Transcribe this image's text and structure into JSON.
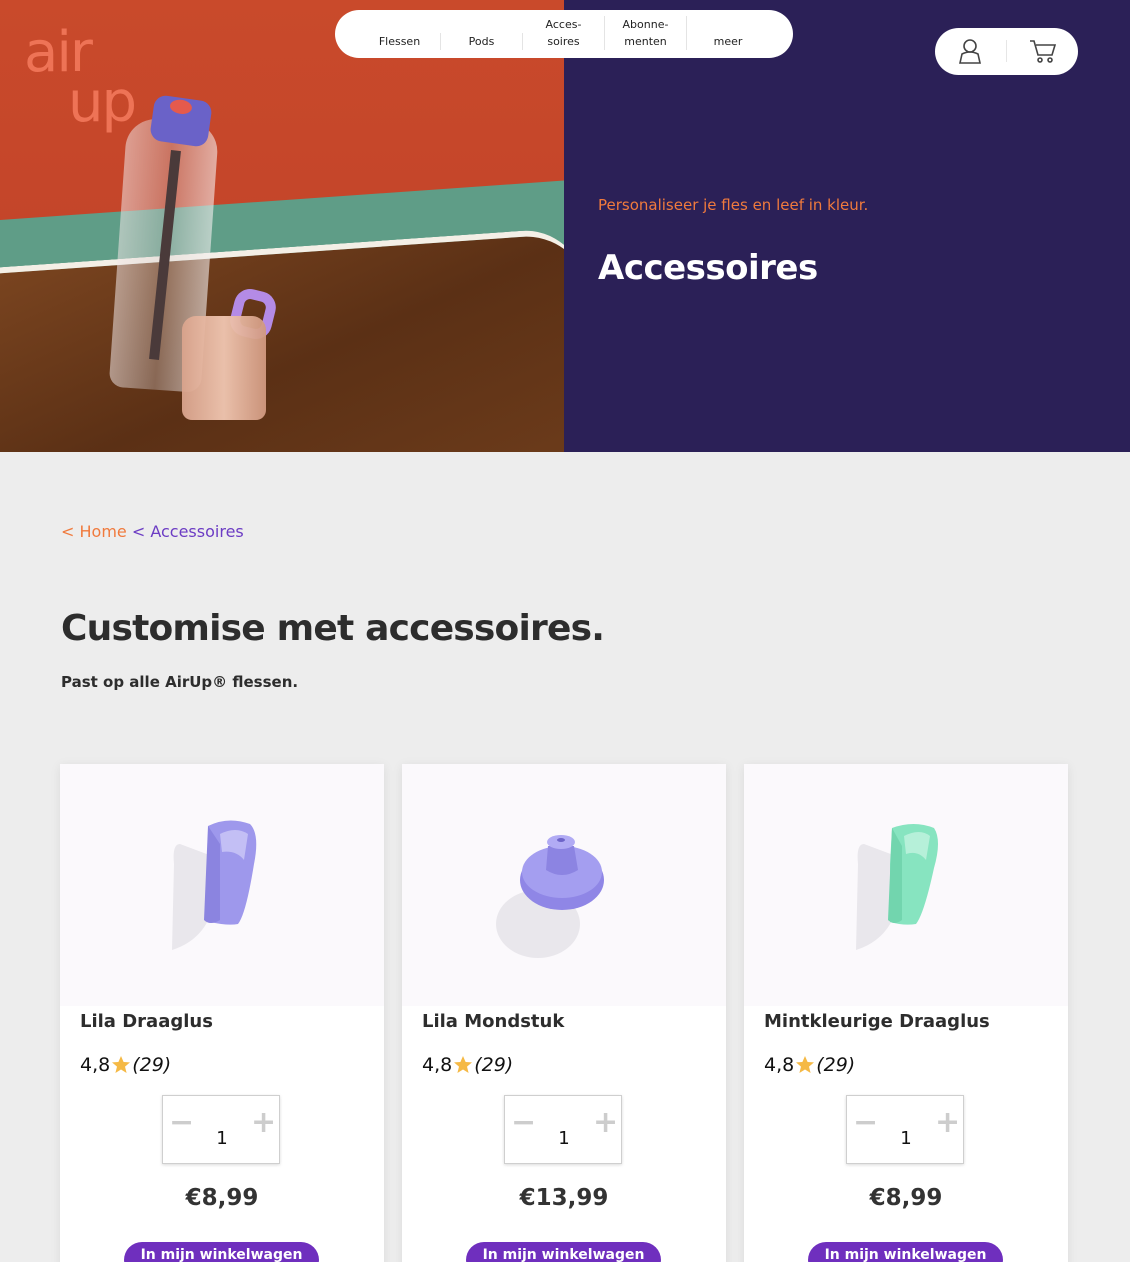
{
  "brand": {
    "logo_line1": "air",
    "logo_line2": "up"
  },
  "nav": {
    "items": [
      {
        "label": "Flessen"
      },
      {
        "label": "Pods"
      },
      {
        "label": "Acces-\nsoires"
      },
      {
        "label": "Abonne-\nmenten"
      },
      {
        "label": "meer"
      }
    ],
    "icons": [
      "user-icon",
      "cart-icon"
    ]
  },
  "hero": {
    "subtitle": "Personaliseer je fles en leef in kleur.",
    "title": "Accessoires"
  },
  "breadcrumb": {
    "home_prefix": "< ",
    "home": "Home",
    "sep": " < ",
    "current": "Accessoires"
  },
  "page": {
    "heading": "Customise met accessoires.",
    "subheading": "Past op alle AirUp® flessen."
  },
  "products": [
    {
      "name": "Lila Draaglus",
      "rating": "4,8",
      "count": "(29)",
      "quantity": "1",
      "price": "€8,99",
      "cta": "In mijn winkelwagen",
      "color": "#8f86e6"
    },
    {
      "name": "Lila Mondstuk",
      "rating": "4,8",
      "count": "(29)",
      "quantity": "1",
      "price": "€13,99",
      "cta": "In mijn winkelwagen",
      "color": "#8f86e6"
    },
    {
      "name": "Mintkleurige Draaglus",
      "rating": "4,8",
      "count": "(29)",
      "quantity": "1",
      "price": "€8,99",
      "cta": "In mijn winkelwagen",
      "color": "#7fe3bf"
    }
  ],
  "colors": {
    "hero_panel": "#2b2057",
    "accent_orange": "#f07a3d",
    "accent_purple": "#6f2fbe",
    "page_bg": "#ededed"
  }
}
